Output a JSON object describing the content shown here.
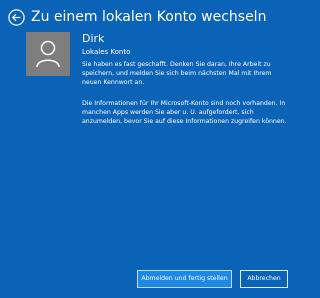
{
  "header": {
    "title": "Zu einem lokalen Konto wechseln",
    "back_icon": "back-arrow-icon"
  },
  "user": {
    "avatar_icon": "user-avatar-icon",
    "name": "Dirk",
    "account_type": "Lokales Konto"
  },
  "body": {
    "message_1": "Sie haben es fast geschafft. Denken Sie daran, Ihre Arbeit zu speichern, und melden Sie sich beim nächsten Mal mit Ihrem neuen Kennwort an.",
    "message_2": "Die Informationen für Ihr Microsoft-Konto sind noch vorhanden. In manchen Apps werden Sie aber u. U. aufgefordert, sich anzumelden, bevor Sie auf diese Informationen zugreifen können."
  },
  "buttons": {
    "primary_label": "Abmelden und fertig stellen",
    "cancel_label": "Abbrechen"
  },
  "colors": {
    "background": "#0b63b8",
    "avatar": "#7e7e7e",
    "primary_button": "#1e88e5"
  }
}
